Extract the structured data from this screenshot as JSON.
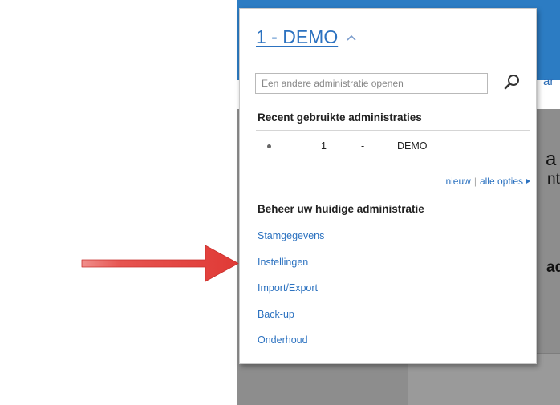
{
  "background": {
    "partial_link": "ar",
    "partial_text_1": "a",
    "partial_text_2": "nt",
    "partial_text_3": "ad"
  },
  "dropdown": {
    "title": "1 - DEMO",
    "search": {
      "placeholder": "Een andere administratie openen"
    },
    "recent": {
      "heading": "Recent gebruikte administraties",
      "items": [
        {
          "number": "1",
          "separator": "-",
          "name": "DEMO"
        }
      ]
    },
    "options": {
      "new_label": "nieuw",
      "divider": "|",
      "all_label": "alle opties"
    },
    "manage": {
      "heading": "Beheer uw huidige administratie",
      "items": [
        {
          "label": "Stamgegevens"
        },
        {
          "label": "Instellingen"
        },
        {
          "label": "Import/Export"
        },
        {
          "label": "Back-up"
        },
        {
          "label": "Onderhoud"
        }
      ]
    }
  },
  "colors": {
    "link": "#2c72c0",
    "topbar": "#2c7cc3",
    "overlay": "#8d8d8d",
    "annotation_arrow": "#e03a36"
  },
  "icons": {
    "title_toggle": "chevron-up-icon",
    "search": "search-icon",
    "all_options": "arrow-right-icon",
    "annotation": "red-arrow-icon"
  }
}
